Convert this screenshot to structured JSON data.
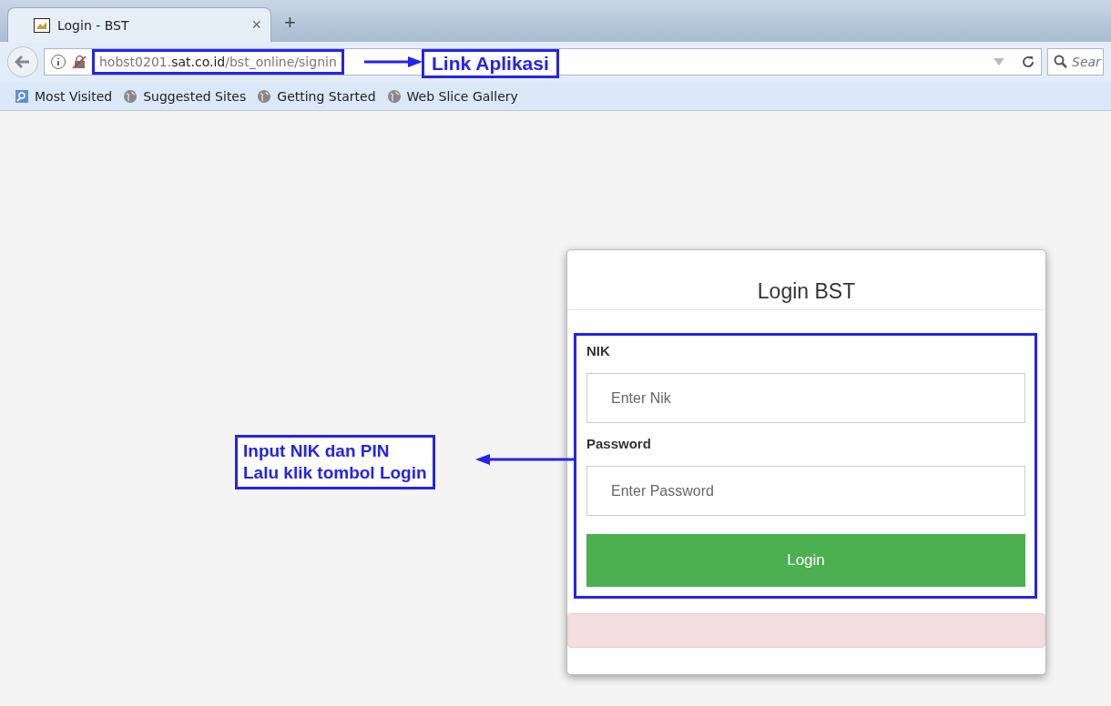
{
  "browser": {
    "tab": {
      "title": "Login - BST",
      "close": "×"
    },
    "new_tab": "+",
    "address": {
      "prefix": "hobst0201.",
      "domain": "sat.co.id",
      "path": "/bst_online/signin"
    },
    "search": {
      "placeholder": "Sear"
    },
    "bookmarks": [
      {
        "label": "Most Visited",
        "kind": "folder"
      },
      {
        "label": "Suggested Sites",
        "kind": "globe"
      },
      {
        "label": "Getting Started",
        "kind": "globe"
      },
      {
        "label": "Web Slice Gallery",
        "kind": "globe"
      }
    ]
  },
  "login": {
    "title": "Login BST",
    "fields": [
      {
        "label": "NIK",
        "placeholder": "Enter Nik"
      },
      {
        "label": "Password",
        "placeholder": "Enter Password"
      }
    ],
    "button": "Login"
  },
  "annotations": {
    "link": "Link Aplikasi",
    "form": [
      "Input NIK dan PIN",
      "Lalu klik tombol Login"
    ]
  }
}
